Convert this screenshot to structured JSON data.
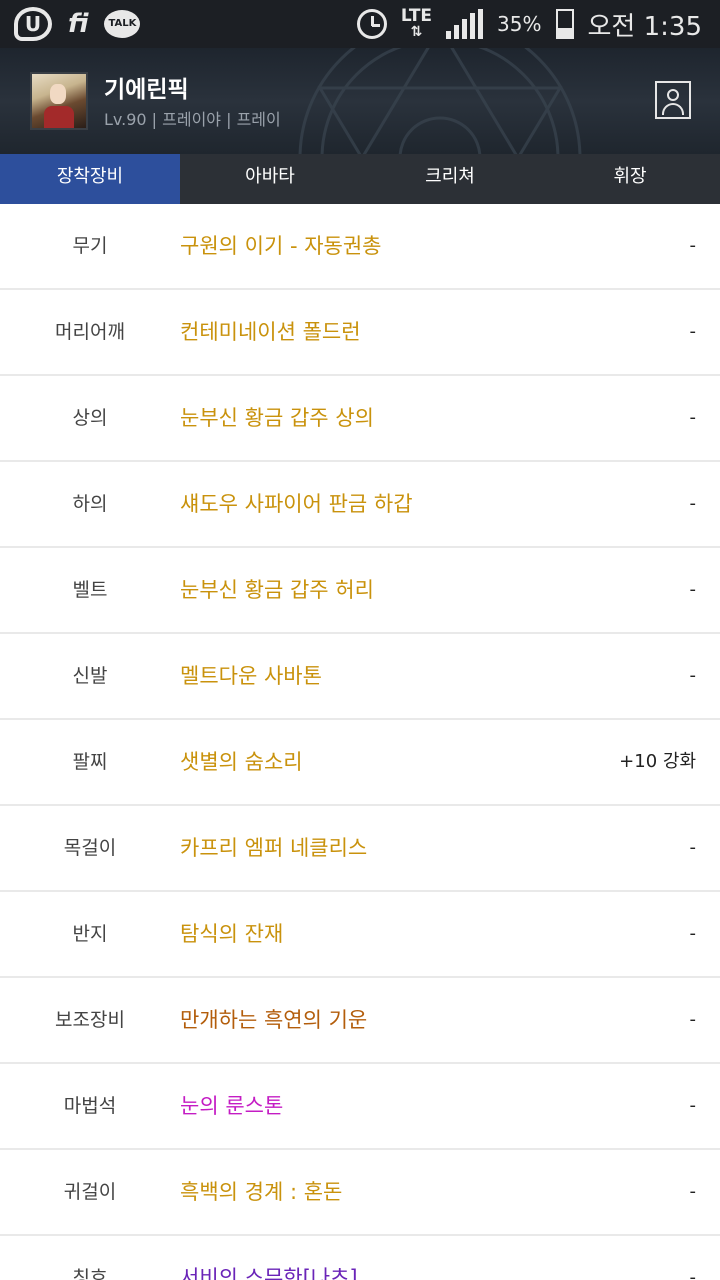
{
  "status_bar": {
    "carrier_icon": "u-plus-icon",
    "wifi_text": "fi",
    "talk_text": "TALK",
    "network": "LTE",
    "battery_pct": "35%",
    "time": "오전 1:35"
  },
  "profile": {
    "name": "기에린픽",
    "info": "Lv.90 | 프레이야 | 프레이"
  },
  "tabs": [
    {
      "label": "장착장비",
      "active": true
    },
    {
      "label": "아바타",
      "active": false
    },
    {
      "label": "크리쳐",
      "active": false
    },
    {
      "label": "휘장",
      "active": false
    }
  ],
  "colors": {
    "tab_active": "#2d4f9c",
    "unique": "#c9920c",
    "legendary": "#b35d0b",
    "magenta": "#c41cc4",
    "purple": "#6a24b8"
  },
  "equipment": [
    {
      "slot": "무기",
      "item": "구원의 이기 - 자동권총",
      "enhance": "-",
      "color": "gold"
    },
    {
      "slot": "머리어깨",
      "item": "컨테미네이션 폴드런",
      "enhance": "-",
      "color": "gold"
    },
    {
      "slot": "상의",
      "item": "눈부신 황금 갑주 상의",
      "enhance": "-",
      "color": "gold"
    },
    {
      "slot": "하의",
      "item": "섀도우 사파이어 판금 하갑",
      "enhance": "-",
      "color": "gold"
    },
    {
      "slot": "벨트",
      "item": "눈부신 황금 갑주 허리",
      "enhance": "-",
      "color": "gold"
    },
    {
      "slot": "신발",
      "item": "멜트다운 사바톤",
      "enhance": "-",
      "color": "gold"
    },
    {
      "slot": "팔찌",
      "item": "샛별의 숨소리",
      "enhance": "+10 강화",
      "color": "gold"
    },
    {
      "slot": "목걸이",
      "item": "카프리 엠퍼 네클리스",
      "enhance": "-",
      "color": "gold"
    },
    {
      "slot": "반지",
      "item": "탐식의 잔재",
      "enhance": "-",
      "color": "gold"
    },
    {
      "slot": "보조장비",
      "item": "만개하는 흑연의 기운",
      "enhance": "-",
      "color": "brown"
    },
    {
      "slot": "마법석",
      "item": "눈의 룬스톤",
      "enhance": "-",
      "color": "magenta"
    },
    {
      "slot": "귀걸이",
      "item": "흑백의 경계 : 혼돈",
      "enhance": "-",
      "color": "gold"
    },
    {
      "slot": "칭호",
      "item": "서비의 스무한[나츠]",
      "enhance": "-",
      "color": "purple"
    }
  ]
}
